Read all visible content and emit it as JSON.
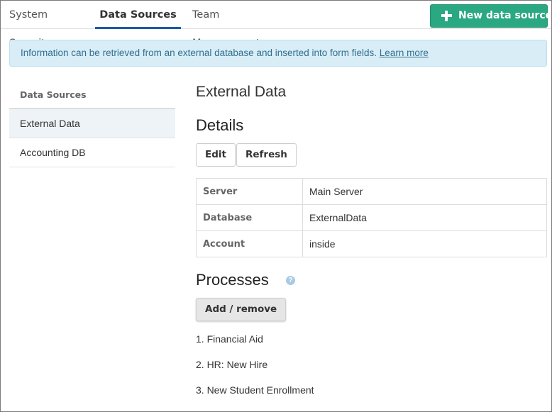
{
  "tabs": [
    {
      "label": "System Security",
      "active": false
    },
    {
      "label": "Data Sources",
      "active": true
    },
    {
      "label": "Team Management",
      "active": false
    }
  ],
  "new_button": {
    "label": "New data source",
    "icon": "plus-icon",
    "color": "#2aa882"
  },
  "banner": {
    "text": "Information can be retrieved from an external database and inserted into form fields.",
    "link": "Learn more"
  },
  "sidebar": {
    "heading": "Data Sources",
    "items": [
      {
        "label": "External Data",
        "selected": true
      },
      {
        "label": "Accounting DB",
        "selected": false
      }
    ]
  },
  "main": {
    "title": "External Data",
    "details_heading": "Details",
    "edit_label": "Edit",
    "refresh_label": "Refresh",
    "details": [
      {
        "key": "Server",
        "value": "Main Server"
      },
      {
        "key": "Database",
        "value": "ExternalData"
      },
      {
        "key": "Account",
        "value": "inside"
      }
    ],
    "processes_heading": "Processes",
    "help_icon": "question-icon",
    "add_remove_label": "Add / remove",
    "processes": [
      "1. Financial Aid",
      "2. HR: New Hire",
      "3. New Student Enrollment"
    ]
  },
  "colors": {
    "accent": "#1b5ca6",
    "banner_bg": "#d9edf7",
    "banner_text": "#31708f"
  }
}
